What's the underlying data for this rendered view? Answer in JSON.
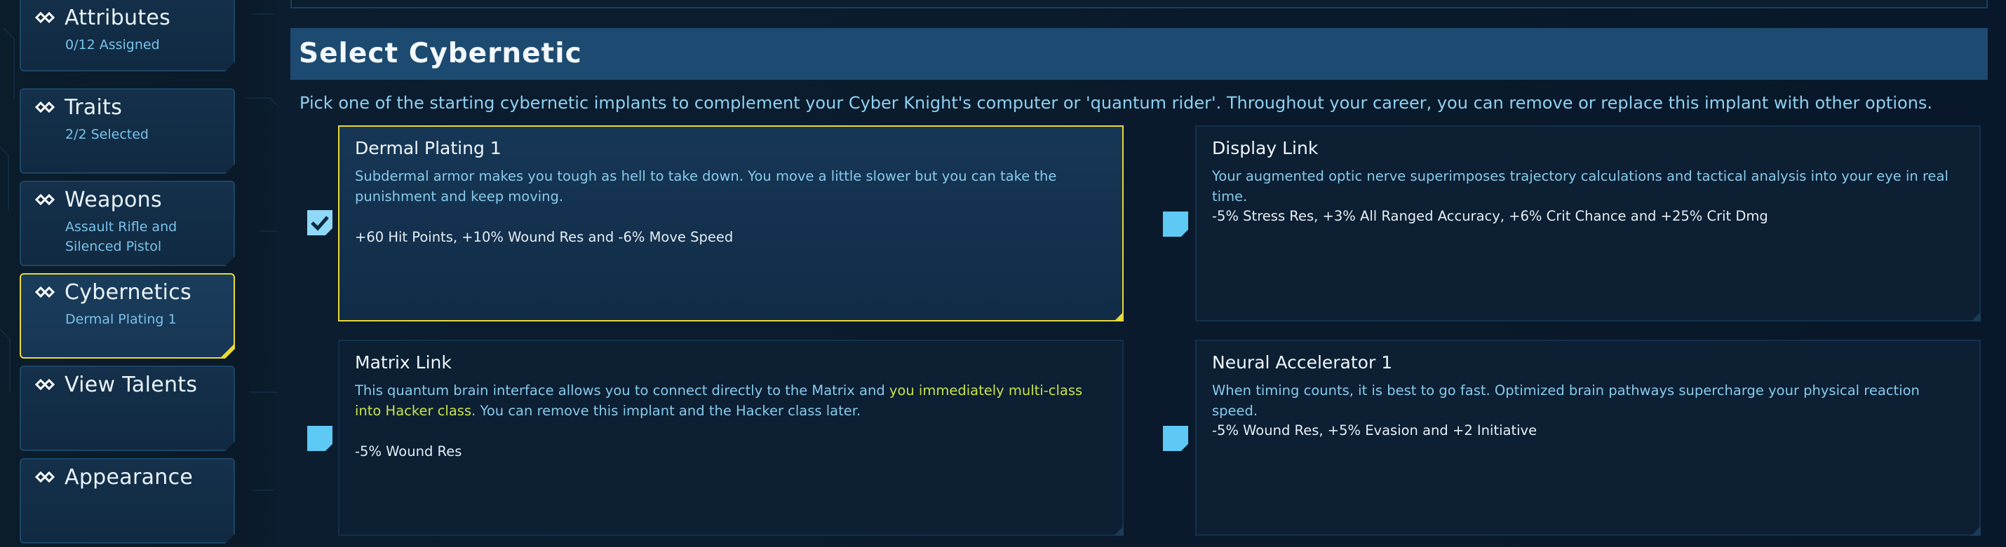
{
  "sidebar": {
    "items": [
      {
        "title": "Attributes",
        "sub": "0/12 Assigned",
        "active": false
      },
      {
        "title": "Traits",
        "sub": "2/2 Selected",
        "active": false
      },
      {
        "title": "Weapons",
        "sub": "Assault Rifle and",
        "sub2": "Silenced Pistol",
        "active": false
      },
      {
        "title": "Cybernetics",
        "sub": "Dermal Plating 1",
        "active": true
      },
      {
        "title": "View Talents",
        "sub": "",
        "active": false
      },
      {
        "title": "Appearance",
        "sub": "",
        "active": false
      }
    ],
    "icon": "chain-link-icon"
  },
  "main": {
    "title": "Select Cybernetic",
    "description": "Pick one of the starting cybernetic implants to complement your Cyber Knight's computer or 'quantum rider'. Throughout your career, you can remove or replace this implant with other options.",
    "cards": [
      {
        "title": "Dermal Plating 1",
        "text": "Subdermal armor makes you tough as hell to take down. You move a little slower but you can take the punishment and keep moving.",
        "stats": "+60 Hit Points, +10% Wound Res and -6% Move Speed",
        "selected": true
      },
      {
        "title": "Display Link",
        "text": "Your augmented optic nerve superimposes trajectory calculations and tactical analysis into your eye in real time.",
        "stats": "-5% Stress Res, +3% All Ranged Accuracy, +6% Crit Chance and +25% Crit Dmg",
        "selected": false
      },
      {
        "title": "Matrix Link",
        "text_before": "This quantum brain interface allows you to connect directly to the Matrix and ",
        "text_highlight": "you immediately multi-class into Hacker class",
        "text_after": ". You can remove this implant and the Hacker class later.",
        "stats": "-5% Wound Res",
        "selected": false
      },
      {
        "title": "Neural Accelerator 1",
        "text": "When timing counts, it is best to go fast. Optimized brain pathways supercharge your physical reaction speed.",
        "stats": "-5% Wound Res, +5% Evasion and +2 Initiative",
        "selected": false
      }
    ]
  },
  "colors": {
    "accent_selected": "#e9d93a",
    "checkbox": "#5dc9f4",
    "highlight_text": "#c8e34a",
    "header_bg": "#1d4a70"
  }
}
